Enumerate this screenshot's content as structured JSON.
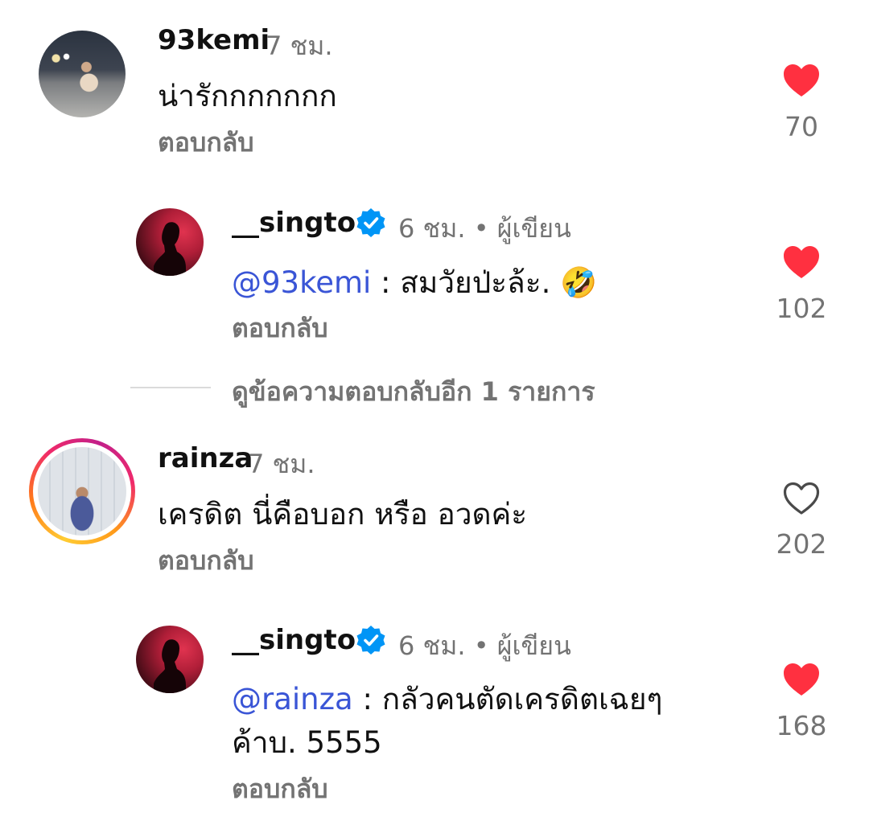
{
  "colors": {
    "like_active": "#ff3040",
    "mention": "#3a55d6",
    "muted": "#737373",
    "verified": "#0095f6"
  },
  "comments": [
    {
      "username": "93kemi",
      "time": "7 ชม.",
      "text": "น่ารักกกกกกก",
      "reply_label": "ตอบกลับ",
      "likes": "70",
      "liked": true,
      "avatar_icon": "profile-photo",
      "replies": [
        {
          "username": "__singto",
          "verified": true,
          "time": "6 ชม. • ผู้เขียน",
          "mention": "@93kemi",
          "text": " : สมวัยป่ะล้ะ. 🤣",
          "reply_label": "ตอบกลับ",
          "likes": "102",
          "liked": true
        }
      ],
      "more_replies_label": "ดูข้อความตอบกลับอีก 1 รายการ"
    },
    {
      "username": "rainza",
      "time": "7 ชม.",
      "text": "เครดิต นี่คือบอก หรือ อวดค่ะ",
      "reply_label": "ตอบกลับ",
      "likes": "202",
      "liked": false,
      "has_story_ring": true,
      "replies": [
        {
          "username": "__singto",
          "verified": true,
          "time": "6 ชม. • ผู้เขียน",
          "mention": "@rainza",
          "text": " : กลัวคนตัดเครดิตเฉยๆ",
          "text_line2": "ค้าบ. 5555",
          "reply_label": "ตอบกลับ",
          "likes": "168",
          "liked": true
        }
      ]
    }
  ]
}
